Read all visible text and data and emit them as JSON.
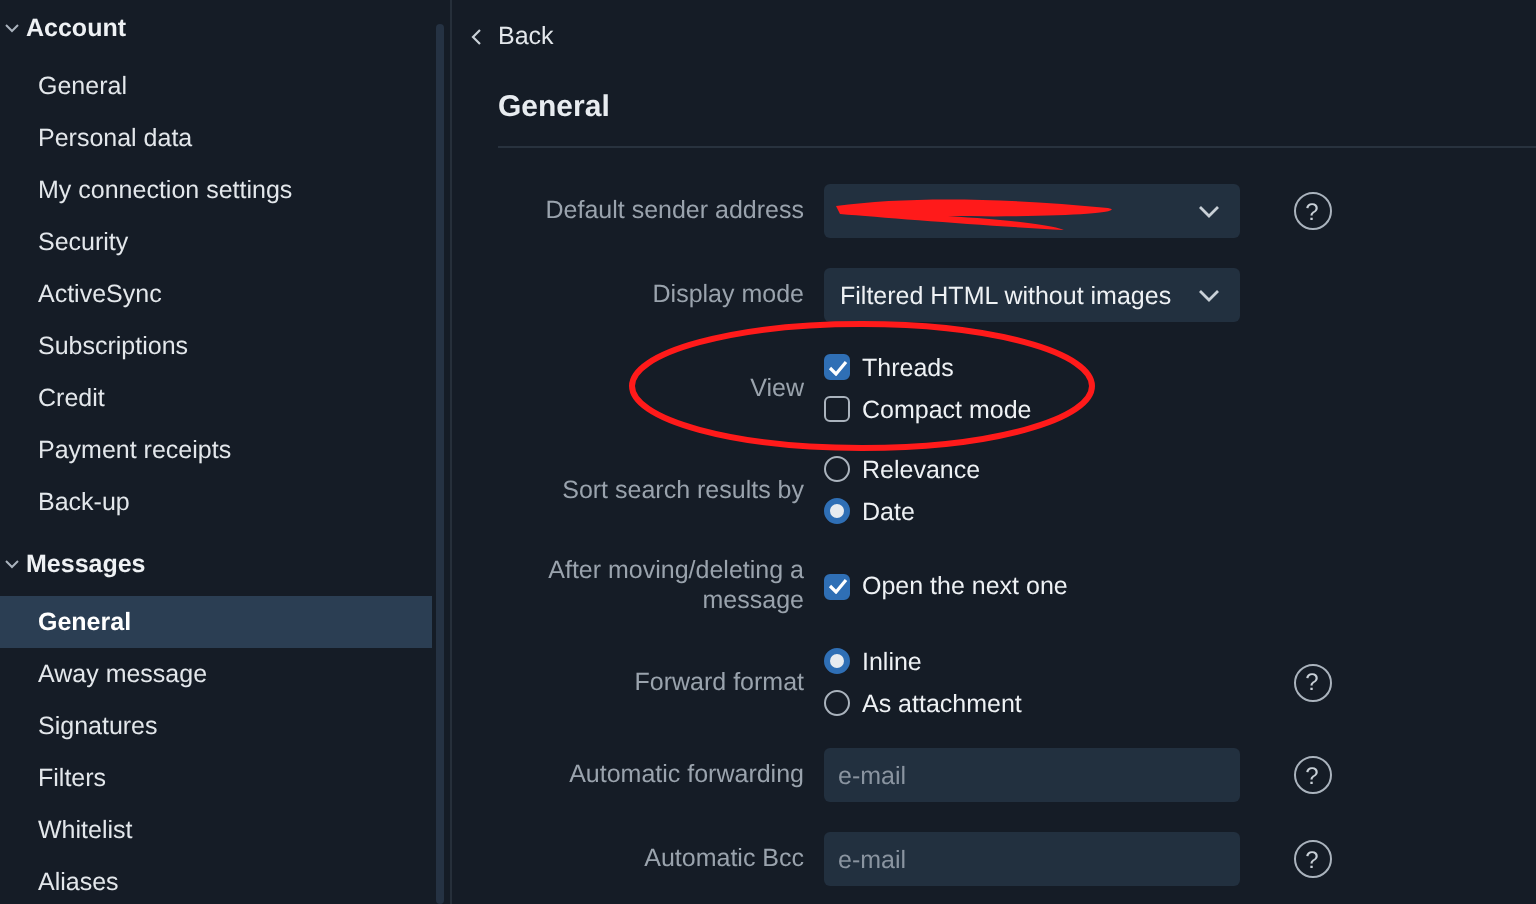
{
  "sidebar": {
    "sections": [
      {
        "title": "Account",
        "expanded": true,
        "items": [
          {
            "label": "General",
            "selected": false
          },
          {
            "label": "Personal data",
            "selected": false
          },
          {
            "label": "My connection settings",
            "selected": false
          },
          {
            "label": "Security",
            "selected": false
          },
          {
            "label": "ActiveSync",
            "selected": false
          },
          {
            "label": "Subscriptions",
            "selected": false
          },
          {
            "label": "Credit",
            "selected": false
          },
          {
            "label": "Payment receipts",
            "selected": false
          },
          {
            "label": "Back-up",
            "selected": false
          }
        ]
      },
      {
        "title": "Messages",
        "expanded": true,
        "items": [
          {
            "label": "General",
            "selected": true
          },
          {
            "label": "Away message",
            "selected": false
          },
          {
            "label": "Signatures",
            "selected": false
          },
          {
            "label": "Filters",
            "selected": false
          },
          {
            "label": "Whitelist",
            "selected": false
          },
          {
            "label": "Aliases",
            "selected": false
          }
        ]
      }
    ]
  },
  "back": "Back",
  "heading": "General",
  "rows": [
    {
      "kind": "select",
      "label": "Default sender address",
      "redacted": true,
      "help": "?"
    },
    {
      "kind": "select",
      "label": "Display mode",
      "value": "Filtered HTML without images"
    },
    {
      "kind": "checkboxes",
      "label": "View",
      "circled": true,
      "options": [
        {
          "label": "Threads",
          "checked": true
        },
        {
          "label": "Compact mode",
          "checked": false
        }
      ]
    },
    {
      "kind": "radios",
      "label": "Sort search results by",
      "options": [
        {
          "label": "Relevance",
          "selected": false
        },
        {
          "label": "Date",
          "selected": true
        }
      ]
    },
    {
      "kind": "checkboxes",
      "label": "After moving/deleting a message",
      "options": [
        {
          "label": "Open the next one",
          "checked": true
        }
      ]
    },
    {
      "kind": "radios",
      "label": "Forward format",
      "help": "?",
      "options": [
        {
          "label": "Inline",
          "selected": true
        },
        {
          "label": "As attachment",
          "selected": false
        }
      ]
    },
    {
      "kind": "input",
      "label": "Automatic forwarding",
      "placeholder": "e-mail",
      "help": "?"
    },
    {
      "kind": "input",
      "label": "Automatic Bcc",
      "placeholder": "e-mail",
      "help": "?"
    }
  ]
}
